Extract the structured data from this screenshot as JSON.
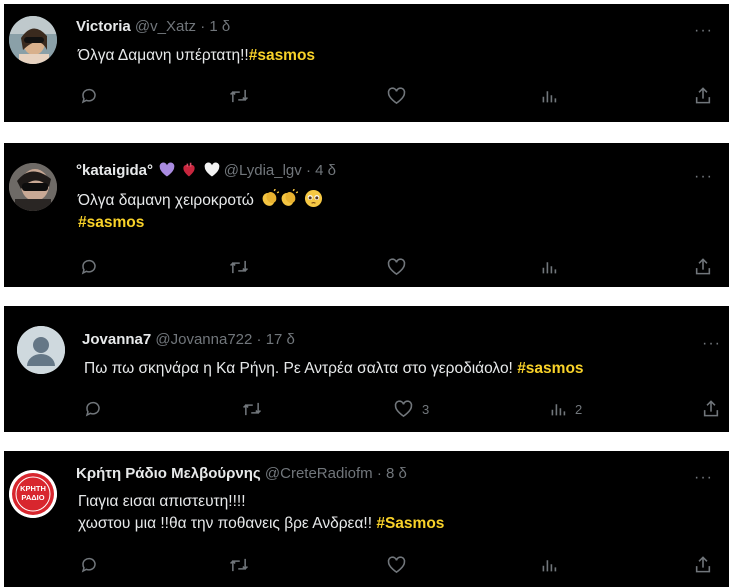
{
  "tweets": [
    {
      "name": "Victoria",
      "handle": "@v_Xatz",
      "separator": "·",
      "time": "1 δ",
      "lines": [
        {
          "text": "Όλγα Δαμανη υπέρτατη!!",
          "tag": "#sasmos"
        }
      ],
      "stats": {
        "reply": "",
        "retweet": "",
        "like": "",
        "views": ""
      }
    },
    {
      "name": "°kataigida°",
      "handle": "@Lydia_lgv",
      "separator": "·",
      "time": "4 δ",
      "lines": [
        {
          "text": "Όλγα δαμανη χειροκροτώ",
          "tag": ""
        },
        {
          "text": "",
          "tag": "#sasmos"
        }
      ],
      "stats": {
        "reply": "",
        "retweet": "",
        "like": "",
        "views": ""
      }
    },
    {
      "name": "Jovanna7",
      "handle": "@Jovanna722",
      "separator": "·",
      "time": "17 δ",
      "lines": [
        {
          "text": "Πω πω σκηνάρα η Κα Ρήνη. Ρε Αντρέα σαλτα στο γεροδιάολο! ",
          "tag": "#sasmos"
        }
      ],
      "stats": {
        "reply": "",
        "retweet": "",
        "like": "3",
        "views": "2"
      }
    },
    {
      "name": "Κρήτη Ράδιο Μελβούρνης",
      "handle": "@CreteRadiofm",
      "separator": "·",
      "time": "8 δ",
      "lines": [
        {
          "text": "Γιαγια εισαι απιστευτη!!!!",
          "tag": ""
        },
        {
          "text": "χωστου μια !!θα την ποθανεις βρε Ανδρεα!! ",
          "tag": "#Sasmos"
        }
      ],
      "avatar_logo": "ΚΡΗΤΗ ΡΑΔΙΟ",
      "stats": {
        "reply": "",
        "retweet": "",
        "like": "",
        "views": ""
      }
    }
  ],
  "icons": {
    "reply": "speech-bubble-icon",
    "retweet": "retweet-arrows-icon",
    "like": "heart-icon",
    "views": "bar-chart-icon",
    "share": "share-upload-icon",
    "more": "more-dots-icon"
  },
  "colors": {
    "background": "#000000",
    "text": "#e7e9ea",
    "muted": "#71767b",
    "hashtag": "#f9d229"
  }
}
